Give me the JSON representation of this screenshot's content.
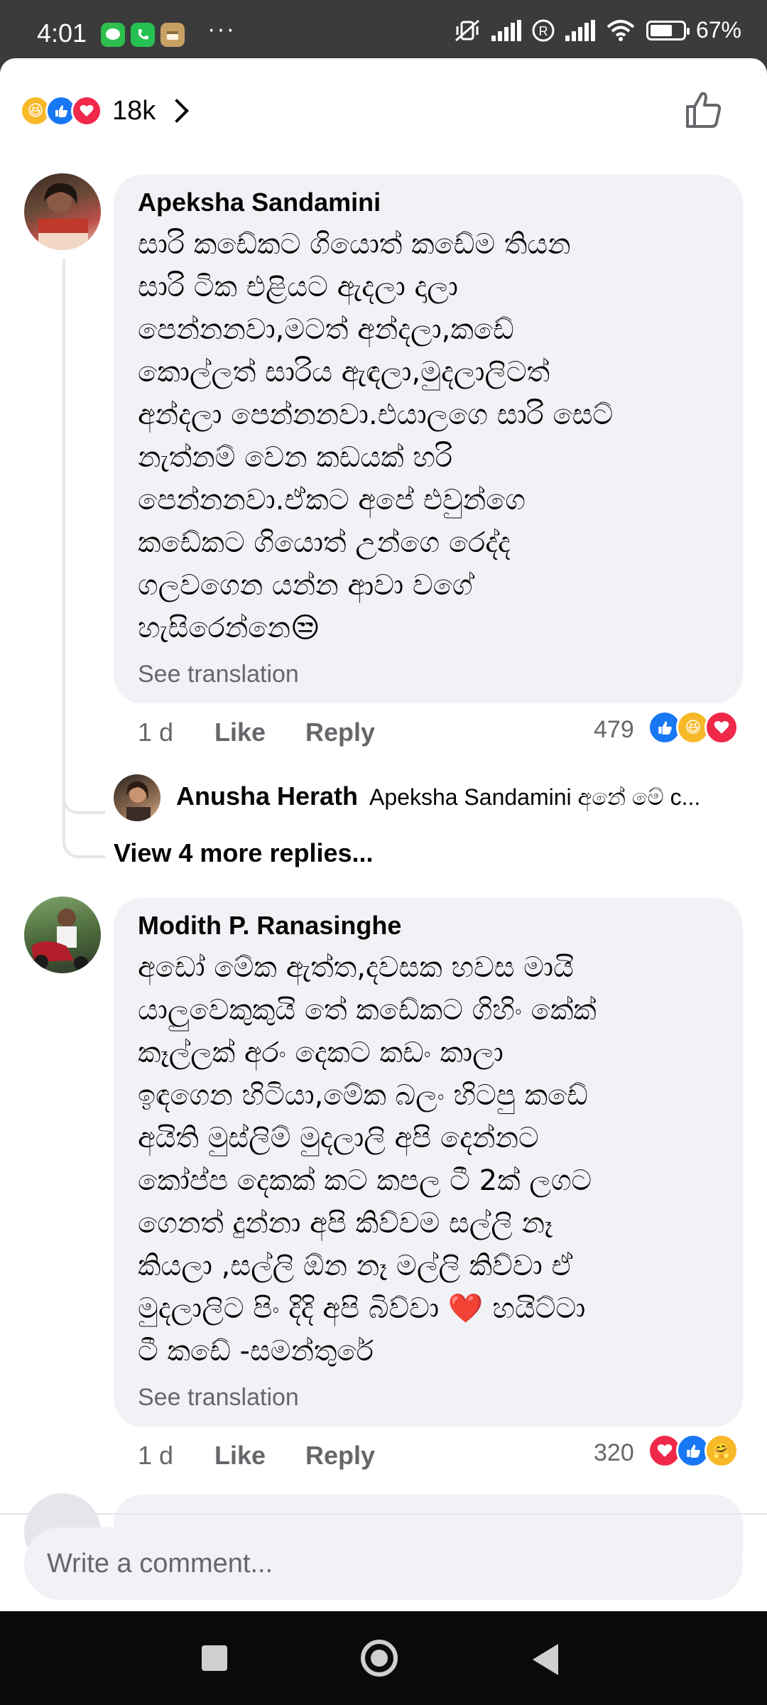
{
  "status_bar": {
    "time": "4:01",
    "dots": "···",
    "battery": "67%"
  },
  "reactions_header": {
    "count": "18k"
  },
  "comments": [
    {
      "author": "Apeksha Sandamini",
      "lines": [
        "සාරි කඩේකට ගියොත් කඩේම තියන",
        "සාරි ටික එළියට ඇදලා දාලා",
        "පෙන්නනවා,මටත් අන්දලා,කඩේ",
        "කොල්ලත් සාරිය ඇඳලා,මුදලාලිටත්",
        "අන්දලා පෙන්නනවා.එයාලගෙ සාරි සෙට්",
        "නැත්නම් වෙන කඩයක් හරි",
        "පෙන්නනවා.ඒකට අපේ එවුන්ගෙ",
        "කඩේකට ගියොත් උන්ගෙ රෙද්ද",
        "ගලවගෙන යන්න ආවා වගේ",
        "හැසිරෙන්නෙ😒"
      ],
      "see_translation": "See translation",
      "age": "1 d",
      "like_label": "Like",
      "reply_label": "Reply",
      "reaction_count": "479",
      "reply": {
        "author": "Anusha Herath",
        "snippet": "Apeksha Sandamini අනේ මේ c..."
      },
      "view_more": "View 4 more replies..."
    },
    {
      "author": "Modith P. Ranasinghe",
      "lines": [
        "අඩෝ මේක ඇත්ත,දවසක හවස මායි",
        "යාලුවෙකුකුයි තේ කඩේකට ගිහිං කේක්",
        "කෑල්ලක් අරං දෙකට කඩං කාලා",
        "ඉඳගෙන හිටියා,මේක බලං හිටපු කඩේ",
        "අයිති මුස්ලිම් මුදලාලි අපි දෙන්නට",
        "කෝප්ප දෙකක් කට කපල ටී 2ක් ලගට",
        "ගෙනත් දුන්නා අපි කිව්වම සල්ලි නෑ",
        "කියලා ,සල්ලි ඕන නෑ මල්ලි කිව්වා ඒ",
        "මුදලාලිට පිං දිදි අපි බිව්වා ❤️  හයිට්ටා",
        "ටී කඩේ -සමන්තුරේ"
      ],
      "see_translation": "See translation",
      "age": "1 d",
      "like_label": "Like",
      "reply_label": "Reply",
      "reaction_count": "320"
    }
  ],
  "composer": {
    "placeholder": "Write a comment..."
  },
  "colors": {
    "like": "#1877f2",
    "love": "#f02849",
    "haha": "#f7b928",
    "bubble": "#f0f2f5",
    "secondary_text": "#65676b"
  }
}
